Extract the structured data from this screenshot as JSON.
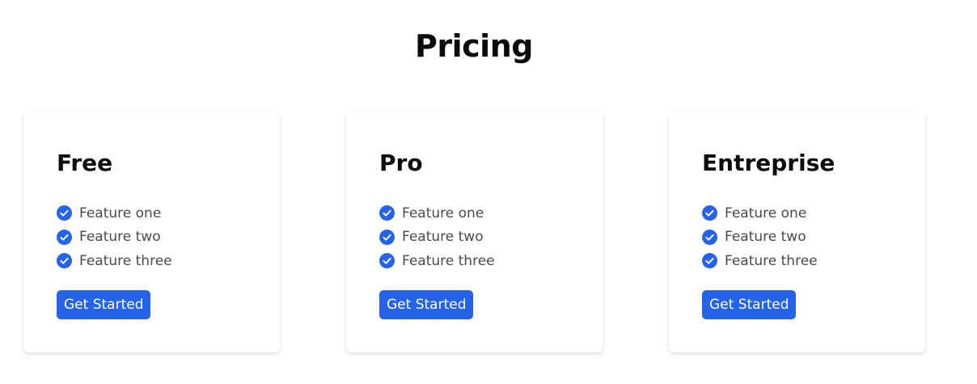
{
  "page": {
    "title": "Pricing"
  },
  "colors": {
    "accent": "#2563eb",
    "feature_text": "#4a4a4a",
    "heading": "#0d0d0d"
  },
  "plans": [
    {
      "name": "Free",
      "features": [
        "Feature one",
        "Feature two",
        "Feature three"
      ],
      "button_label": "Get Started",
      "feature_icon": "check-circle-icon"
    },
    {
      "name": "Pro",
      "features": [
        "Feature one",
        "Feature two",
        "Feature three"
      ],
      "button_label": "Get Started",
      "feature_icon": "check-circle-icon"
    },
    {
      "name": "Entreprise",
      "features": [
        "Feature one",
        "Feature two",
        "Feature three"
      ],
      "button_label": "Get Started",
      "feature_icon": "check-circle-icon"
    }
  ]
}
